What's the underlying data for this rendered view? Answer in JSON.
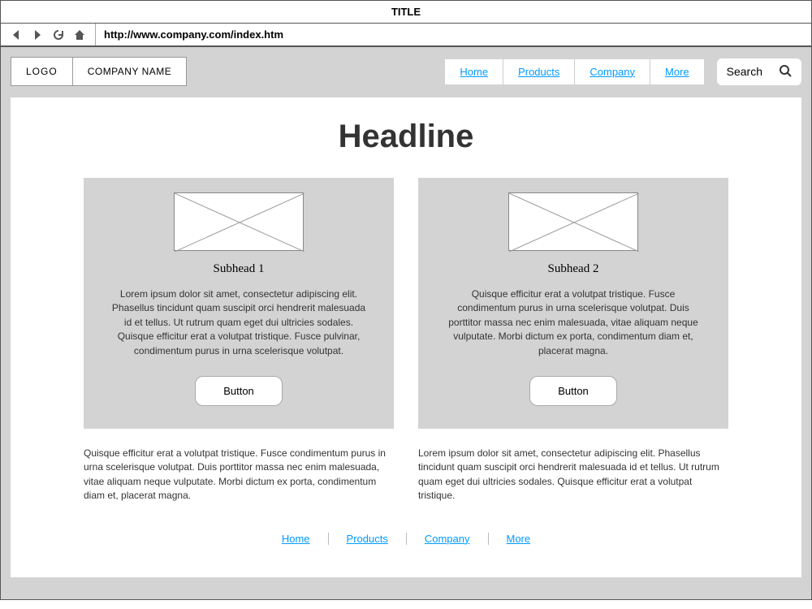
{
  "browser": {
    "title": "TITLE",
    "url": "http://www.company.com/index.htm"
  },
  "header": {
    "logo": "LOGO",
    "company_name": "COMPANY NAME",
    "nav": [
      "Home",
      "Products",
      "Company",
      "More"
    ],
    "search_placeholder": "Search"
  },
  "main": {
    "headline": "Headline",
    "cards": [
      {
        "subhead": "Subhead 1",
        "body": "Lorem ipsum dolor sit amet, consectetur adipiscing elit. Phasellus tincidunt quam suscipit orci hendrerit malesuada id et tellus. Ut rutrum quam eget dui ultricies sodales. Quisque efficitur erat a volutpat tristique. Fusce pulvinar, condimentum purus in urna scelerisque volutpat.",
        "button_label": "Button"
      },
      {
        "subhead": "Subhead 2",
        "body": "Quisque efficitur erat a volutpat tristique. Fusce condimentum purus in urna scelerisque volutpat. Duis porttitor massa nec enim malesuada, vitae aliquam neque vulputate. Morbi dictum ex porta, condimentum diam et, placerat magna.",
        "button_label": "Button"
      }
    ],
    "lower_texts": [
      "Quisque efficitur erat a volutpat tristique. Fusce condimentum purus in urna scelerisque volutpat. Duis porttitor massa nec enim malesuada, vitae aliquam neque vulputate. Morbi dictum ex porta, condimentum diam et, placerat magna.",
      "Lorem ipsum dolor sit amet, consectetur adipiscing elit. Phasellus tincidunt quam suscipit orci hendrerit malesuada id et tellus. Ut rutrum quam eget dui ultricies sodales. Quisque efficitur erat a volutpat tristique."
    ]
  },
  "footer": {
    "nav": [
      "Home",
      "Products",
      "Company",
      "More"
    ]
  }
}
